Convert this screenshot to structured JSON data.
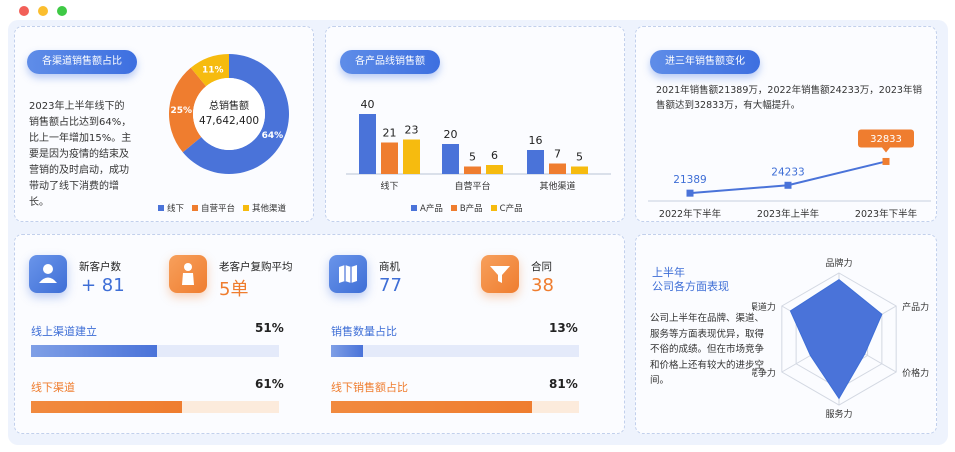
{
  "colors": {
    "blue": "#4a73d9",
    "orange": "#ef7d2f",
    "yellow": "#f6bb0f"
  },
  "channel": {
    "title": "各渠道销售额占比",
    "description": "2023年上半年线下的销售额占比达到64%，比上一年增加15%。主要是因为疫情的结束及营销的及时启动，成功带动了线下消费的增长。",
    "center_label": "总销售额",
    "center_value": "47,642,400",
    "legend": [
      "线下",
      "自营平台",
      "其他渠道"
    ]
  },
  "product": {
    "title": "各产品线销售额",
    "legend": [
      "A产品",
      "B产品",
      "C产品"
    ]
  },
  "trend": {
    "title": "进三年销售额变化",
    "description": "2021年销售额21389万，2022年销售额24233万，2023年销售额达到32833万，有大幅提升。"
  },
  "stats": [
    {
      "icon": "user-icon",
      "label": "新客户数",
      "value": "+ 81"
    },
    {
      "icon": "person-icon",
      "label": "老客户复购平均",
      "value": "5单"
    },
    {
      "icon": "map-icon",
      "label": "商机",
      "value": "77"
    },
    {
      "icon": "filter-icon",
      "label": "合同",
      "value": "38"
    }
  ],
  "progress": [
    {
      "label": "线上渠道建立",
      "pct_text": "51%",
      "value": 0.51
    },
    {
      "label": "线下渠道",
      "pct_text": "61%",
      "value": 0.61
    },
    {
      "label": "销售数量占比",
      "pct_text": "13%",
      "value": 0.13
    },
    {
      "label": "线下销售额占比",
      "pct_text": "81%",
      "value": 0.81
    }
  ],
  "radar_panel": {
    "title_line1": "上半年",
    "title_line2": "公司各方面表现",
    "description": "公司上半年在品牌、渠道、服务等方面表现优异，取得不俗的成绩。但在市场竞争和价格上还有较大的进步空间。"
  },
  "chart_data": [
    {
      "type": "pie",
      "title": "",
      "categories": [
        "线下",
        "自营平台",
        "其他渠道"
      ],
      "values": [
        64,
        25,
        11
      ],
      "labels": [
        "64%",
        "25%",
        "11%"
      ]
    },
    {
      "type": "bar",
      "title": "",
      "categories": [
        "线下",
        "自营平台",
        "其他渠道"
      ],
      "series": [
        {
          "name": "A产品",
          "values": [
            40,
            20,
            16
          ]
        },
        {
          "name": "B产品",
          "values": [
            21,
            5,
            7
          ]
        },
        {
          "name": "C产品",
          "values": [
            23,
            6,
            5
          ]
        }
      ],
      "ylim": [
        0,
        40
      ],
      "grid": false
    },
    {
      "type": "line",
      "title": "",
      "categories": [
        "2022年下半年",
        "2023年上半年",
        "2023年下半年"
      ],
      "values": [
        21389,
        24233,
        32833
      ],
      "labels": [
        "21389",
        "24233",
        "32833"
      ]
    },
    {
      "type": "radar",
      "title": "",
      "categories": [
        "品牌力",
        "产品力",
        "价格力",
        "服务力",
        "竞争力",
        "渠道力"
      ],
      "values": [
        0.9,
        0.75,
        0.45,
        0.9,
        0.5,
        0.85
      ],
      "rmax": 1
    }
  ]
}
